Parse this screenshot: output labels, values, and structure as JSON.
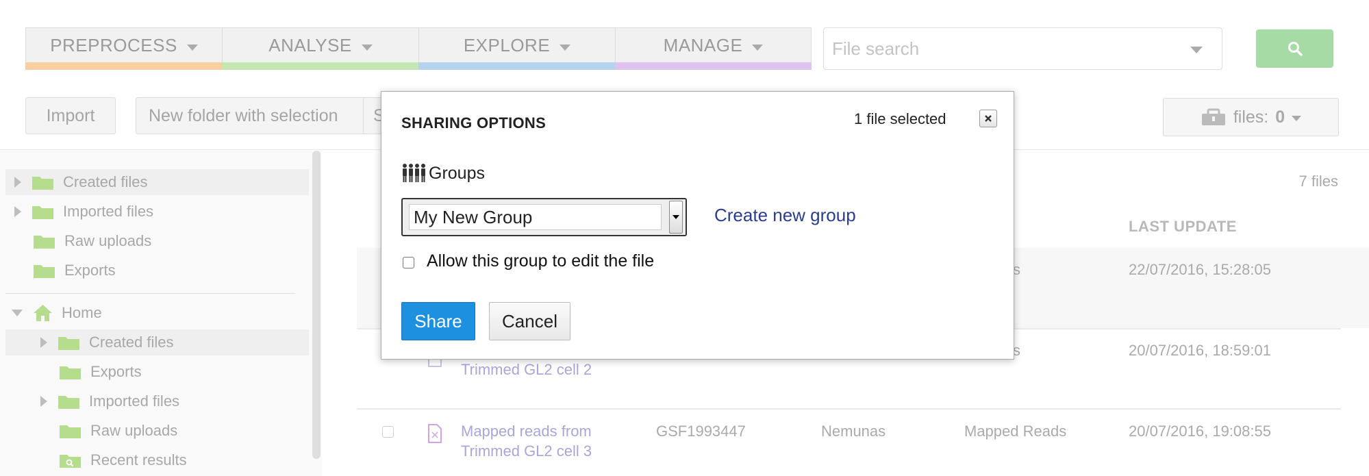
{
  "topnav": {
    "tabs": [
      {
        "label": "PREPROCESS",
        "color": "#f8cfa1"
      },
      {
        "label": "ANALYSE",
        "color": "#c6e6b3"
      },
      {
        "label": "EXPLORE",
        "color": "#b5d3ee"
      },
      {
        "label": "MANAGE",
        "color": "#dcc4ef"
      }
    ],
    "search_placeholder": "File search",
    "search_button_icon": "search-icon"
  },
  "toolbar": {
    "import_label": "Import",
    "new_folder_label": "New folder with selection",
    "partial_label": "S",
    "files_label": "files:",
    "files_count": "0"
  },
  "sidebar": {
    "items": [
      {
        "label": "Created files"
      },
      {
        "label": "Imported files"
      },
      {
        "label": "Raw uploads"
      },
      {
        "label": "Exports"
      },
      {
        "label": "Home"
      },
      {
        "label": "Created files"
      },
      {
        "label": "Exports"
      },
      {
        "label": "Imported files"
      },
      {
        "label": "Raw uploads"
      },
      {
        "label": "Recent results"
      }
    ]
  },
  "content": {
    "file_count": "7 files",
    "last_update_header": "LAST UPDATE",
    "rows": [
      {
        "name_line1": "",
        "name_line2": "",
        "id": "",
        "owner": "",
        "type": "d Reads",
        "updated": "22/07/2016, 15:28:05"
      },
      {
        "name_line1": "",
        "name_line2": "Trimmed GL2 cell 2",
        "id": "",
        "owner": "",
        "type": "d Reads",
        "updated": "20/07/2016, 18:59:01"
      },
      {
        "name_line1": "Mapped reads from",
        "name_line2": "Trimmed GL2 cell 3",
        "id": "GSF1993447",
        "owner": "Nemunas",
        "type": "Mapped Reads",
        "updated": "20/07/2016, 19:08:55"
      }
    ]
  },
  "modal": {
    "title": "SHARING OPTIONS",
    "selected_count": "1 file selected",
    "groups_label": "Groups",
    "group_select_value": "My New Group",
    "create_group_link": "Create new group",
    "allow_edit_label": "Allow this group to edit the file",
    "share_label": "Share",
    "cancel_label": "Cancel"
  }
}
